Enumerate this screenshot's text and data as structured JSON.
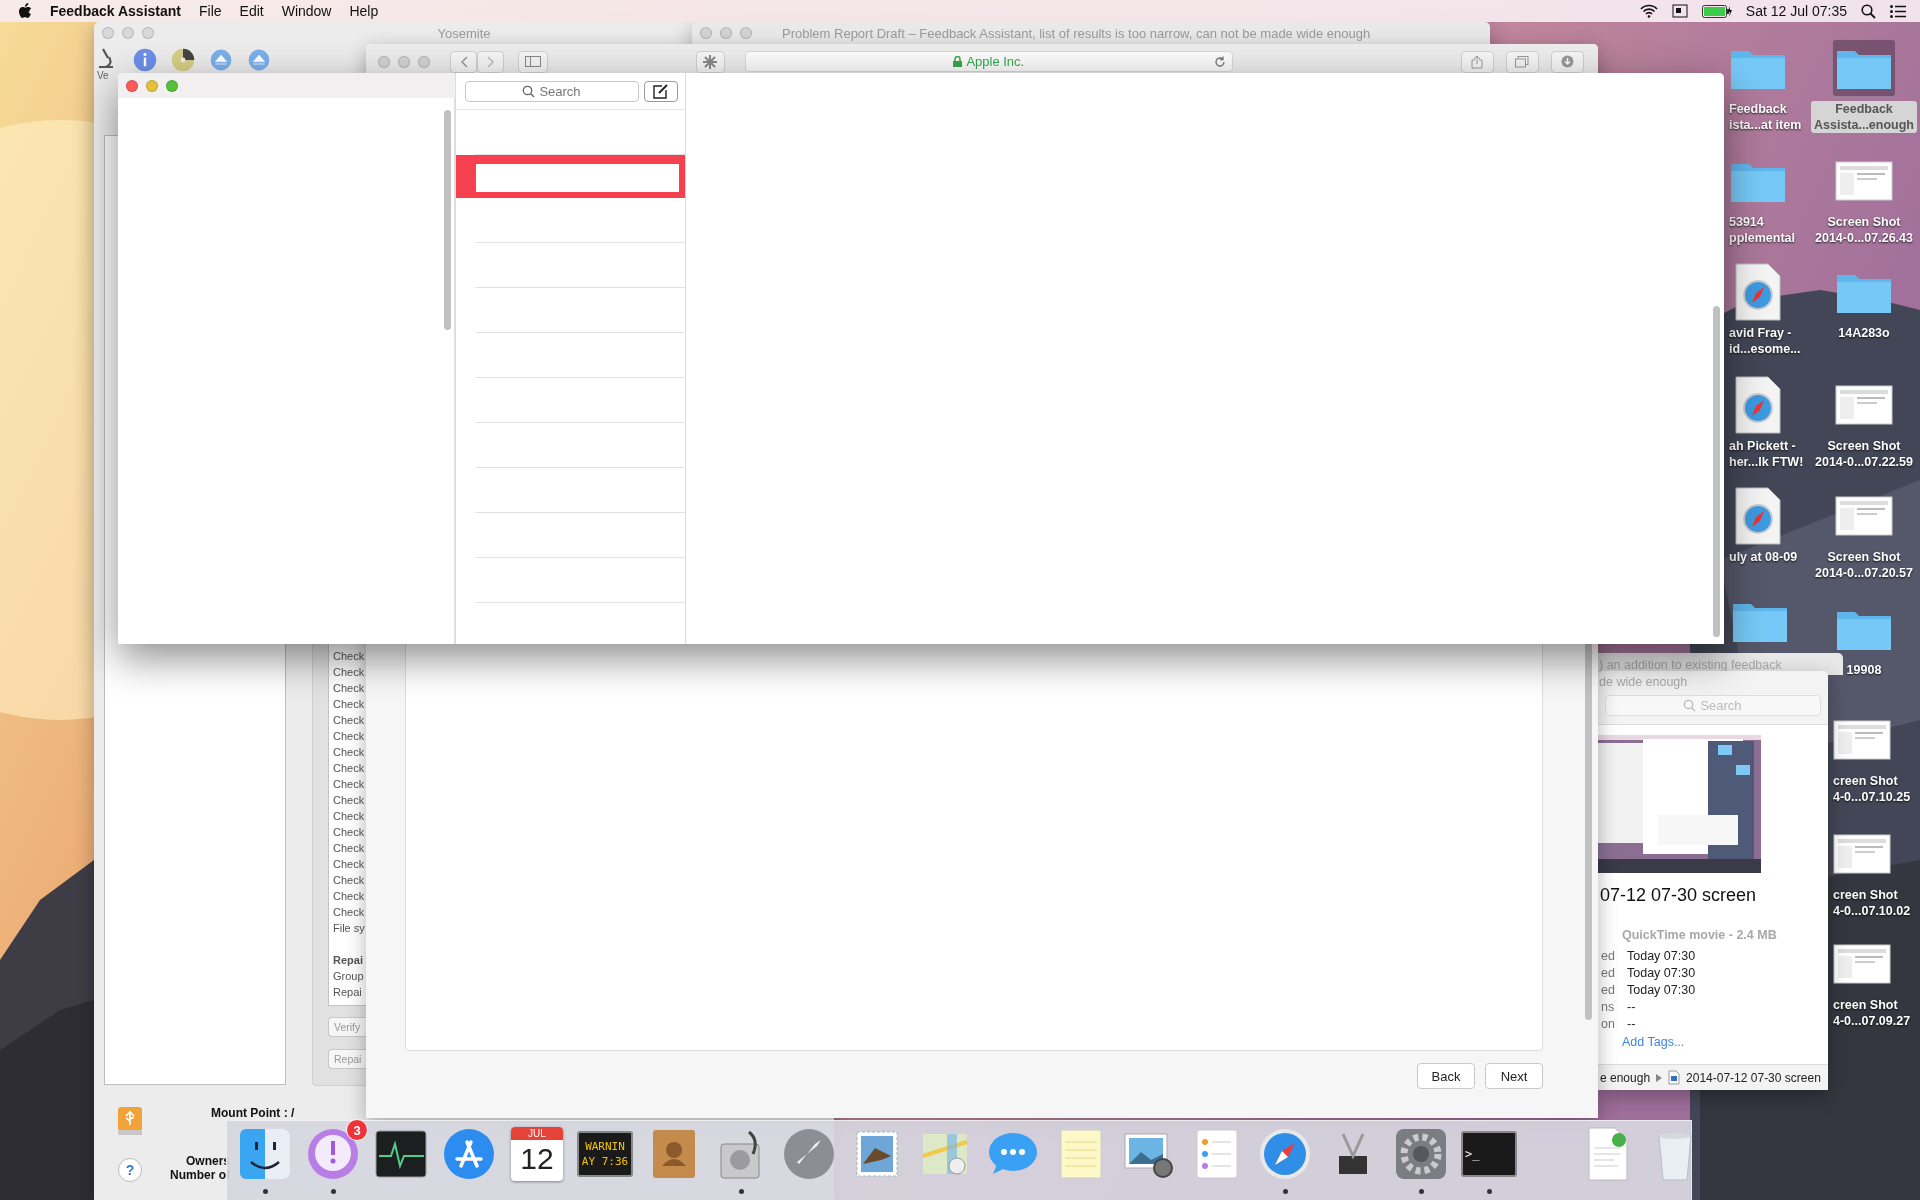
{
  "menu_bar": {
    "app_name": "Feedback Assistant",
    "menus": [
      "File",
      "Edit",
      "Window",
      "Help"
    ],
    "clock": "Sat 12 Jul  07:35"
  },
  "disk_utility": {
    "title": "Yosemite",
    "toolbar_label": "Ve",
    "log_groups": [
      [
        {
          "text": "Check",
          "bold": false
        },
        {
          "text": "Check",
          "bold": false
        },
        {
          "text": "Check",
          "bold": false
        },
        {
          "text": "Check",
          "bold": false
        },
        {
          "text": "Check",
          "bold": false
        },
        {
          "text": "Check",
          "bold": false
        },
        {
          "text": "Check",
          "bold": false
        },
        {
          "text": "Check",
          "bold": false
        },
        {
          "text": "Check",
          "bold": false
        },
        {
          "text": "Check",
          "bold": false
        },
        {
          "text": "Check",
          "bold": false
        },
        {
          "text": "Check",
          "bold": false
        },
        {
          "text": "Check",
          "bold": false
        },
        {
          "text": "Check",
          "bold": false
        },
        {
          "text": "Check",
          "bold": false
        },
        {
          "text": "Check",
          "bold": false
        },
        {
          "text": "Check",
          "bold": false
        },
        {
          "text": "File sy",
          "bold": false
        }
      ],
      [
        {
          "text": "Repai",
          "bold": true
        },
        {
          "text": "Group",
          "bold": false
        },
        {
          "text": "Repai",
          "bold": false
        }
      ]
    ],
    "buttons": [
      "Verify",
      "Repai"
    ],
    "mount_point": "Mount Point : /",
    "info_labels": [
      "Owners",
      "Number of"
    ],
    "help_button": "?"
  },
  "report_draft": {
    "title": "Problem Report Draft – Feedback Assistant, list of results is too narrow, can not be made wide enough"
  },
  "safari": {
    "address": "Apple Inc.",
    "secure": true,
    "buttons": [
      "Back",
      "Next"
    ]
  },
  "feedback_window": {
    "search": {
      "placeholder": "Search"
    },
    "results": [
      {
        "selected": false
      },
      {
        "selected": true
      },
      {
        "selected": false
      },
      {
        "selected": false
      },
      {
        "selected": false
      },
      {
        "selected": false
      },
      {
        "selected": false
      },
      {
        "selected": false
      },
      {
        "selected": false
      },
      {
        "selected": false
      },
      {
        "selected": false
      }
    ]
  },
  "info_window": {
    "back_title": ") an addition to existing feedback",
    "title": "de wide enough",
    "search": {
      "placeholder": "Search"
    },
    "file_name": "07-12 07-30 screen",
    "file_kind": "QuickTime movie - 2.4 MB",
    "fields": [
      {
        "label": "ed",
        "value": "Today 07:30"
      },
      {
        "label": "ed",
        "value": "Today 07:30"
      },
      {
        "label": "ed",
        "value": "Today 07:30"
      },
      {
        "label": "ns",
        "value": "--"
      },
      {
        "label": "on",
        "value": "--"
      }
    ],
    "add_tags": "Add Tags...",
    "path": [
      "e enough",
      "2014-07-12 07-30 screen"
    ]
  },
  "desktop_icons": [
    {
      "kind": "folder",
      "label_lines": [
        "Feedback",
        "ista...at item"
      ],
      "selected": false
    },
    {
      "kind": "folder",
      "label_lines": [
        "53914",
        "pplemental"
      ],
      "selected": false
    },
    {
      "kind": "webpage",
      "label_lines": [
        "avid Fray -",
        "id...esome..."
      ],
      "selected": false
    },
    {
      "kind": "webpage",
      "label_lines": [
        "ah Pickett -",
        "her...lk FTW!"
      ],
      "selected": false
    },
    {
      "kind": "webpage",
      "label_lines": [
        "uly at 08-09"
      ],
      "selected": false
    },
    {
      "kind": "folder",
      "selected": false
    },
    {
      "kind": "folder",
      "label_lines": [
        "Feedback",
        "Assista...enough"
      ],
      "selected": true
    },
    {
      "kind": "screenshot",
      "label_lines": [
        "Screen Shot",
        "2014-0...07.26.43"
      ],
      "selected": false
    },
    {
      "kind": "folder",
      "label_lines": [
        "14A283o"
      ],
      "selected": false
    },
    {
      "kind": "screenshot",
      "label_lines": [
        "Screen Shot",
        "2014-0...07.22.59"
      ],
      "selected": false
    },
    {
      "kind": "screenshot",
      "label_lines": [
        "Screen Shot",
        "2014-0...07.20.57"
      ],
      "selected": false
    },
    {
      "kind": "folder",
      "label_lines": [
        "19908"
      ],
      "selected": false
    },
    {
      "kind": "screenshot",
      "label_lines": [
        "creen Shot",
        "4-0...07.10.25"
      ],
      "selected": false
    },
    {
      "kind": "screenshot",
      "label_lines": [
        "creen Shot",
        "4-0...07.10.02"
      ],
      "selected": false
    },
    {
      "kind": "screenshot",
      "label_lines": [
        "creen Shot",
        "4-0...07.09.27"
      ],
      "selected": false
    }
  ],
  "dock": {
    "apps": [
      {
        "kind": "finder",
        "running": true
      },
      {
        "kind": "feedback",
        "running": true,
        "badge": "3"
      },
      {
        "kind": "activity",
        "running": false
      },
      {
        "kind": "appstore",
        "running": false
      },
      {
        "kind": "calendar",
        "running": false,
        "lines": [
          "JUL",
          "12"
        ]
      },
      {
        "kind": "console",
        "running": false,
        "lines": [
          "WARNIN",
          "AY 7:36"
        ]
      },
      {
        "kind": "contacts",
        "running": false
      },
      {
        "kind": "diskutility",
        "running": true
      },
      {
        "kind": "launchpad",
        "running": false
      },
      {
        "kind": "mail",
        "running": false
      },
      {
        "kind": "maps",
        "running": false
      },
      {
        "kind": "messages",
        "running": false
      },
      {
        "kind": "notes",
        "running": false
      },
      {
        "kind": "preview",
        "running": false
      },
      {
        "kind": "reminders",
        "running": false
      },
      {
        "kind": "safari",
        "running": true
      },
      {
        "kind": "sysinfo",
        "running": false
      },
      {
        "kind": "sysprefs",
        "running": true
      },
      {
        "kind": "terminal",
        "running": true,
        "lines": [
          ">_"
        ]
      }
    ],
    "others": [
      {
        "kind": "document",
        "running": false
      },
      {
        "kind": "trash",
        "running": false
      }
    ]
  }
}
